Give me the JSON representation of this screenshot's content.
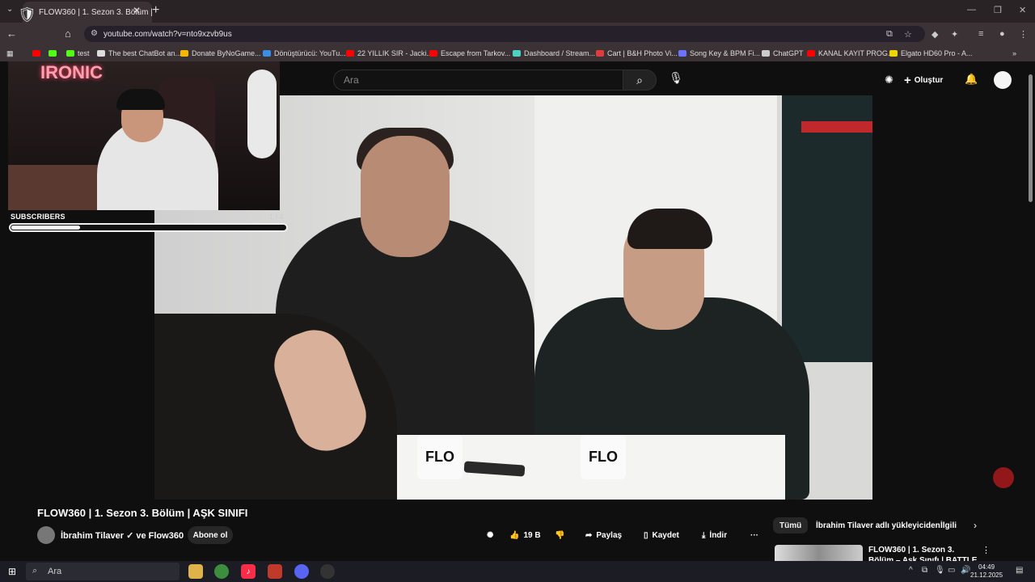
{
  "browser": {
    "tab_title": "FLOW360 | 1. Sezon 3. Bölüm | AŞK SINIFI",
    "url": "youtube.com/watch?v=nto9xzvb9us",
    "bookmarks": [
      {
        "label": "",
        "color": "#ff0000"
      },
      {
        "label": "",
        "color": "#53fc18"
      },
      {
        "label": "test",
        "color": "#53fc18"
      },
      {
        "label": "The best ChatBot an...",
        "color": "#dddddd"
      },
      {
        "label": "Donate ByNoGame...",
        "color": "#f5b800"
      },
      {
        "label": "Dönüştürücü: YouTu...",
        "color": "#3a8ee6"
      },
      {
        "label": "22 YILLIK SIR - Jacki...",
        "color": "#ff0000"
      },
      {
        "label": "Escape from Tarkov...",
        "color": "#ff0000"
      },
      {
        "label": "Dashboard / Stream...",
        "color": "#4fd1c5"
      },
      {
        "label": "Cart | B&H Photo Vi...",
        "color": "#e23b3b"
      },
      {
        "label": "Song Key & BPM Fi...",
        "color": "#6b73ff"
      },
      {
        "label": "ChatGPT",
        "color": "#cccccc"
      },
      {
        "label": "KANAL KAYIT PROG...",
        "color": "#ff0000"
      },
      {
        "label": "Elgato HD60 Pro - A...",
        "color": "#f2d600"
      }
    ]
  },
  "youtube": {
    "search_placeholder": "Ara",
    "create_label": "Oluştur",
    "video_title": "FLOW360 | 1. Sezon 3. Bölüm | AŞK SINIFI",
    "channel": "İbrahim Tilaver ✓ ve Flow360",
    "subscribe_label": "Abone ol",
    "likes": "19 B",
    "share_label": "Paylaş",
    "save_label": "Kaydet",
    "download_label": "İndir",
    "mug_text": "FLO",
    "chips": {
      "all": "Tümü",
      "uploader": "İbrahim Tilaver adlı yükleyiciden",
      "related": "İlgili"
    },
    "rec_title": "FLOW360 | 1. Sezon 3. Bölüm – Aşk Sınıfı | BATTLE"
  },
  "overlay": {
    "neon_text": "IRONIC",
    "subs_label": "SUBSCRIBERS",
    "subs_count": "1 / 4",
    "subs_progress": 0.25
  },
  "taskbar": {
    "search": "Ara",
    "time": "04:49",
    "date": "21.12.2025"
  }
}
